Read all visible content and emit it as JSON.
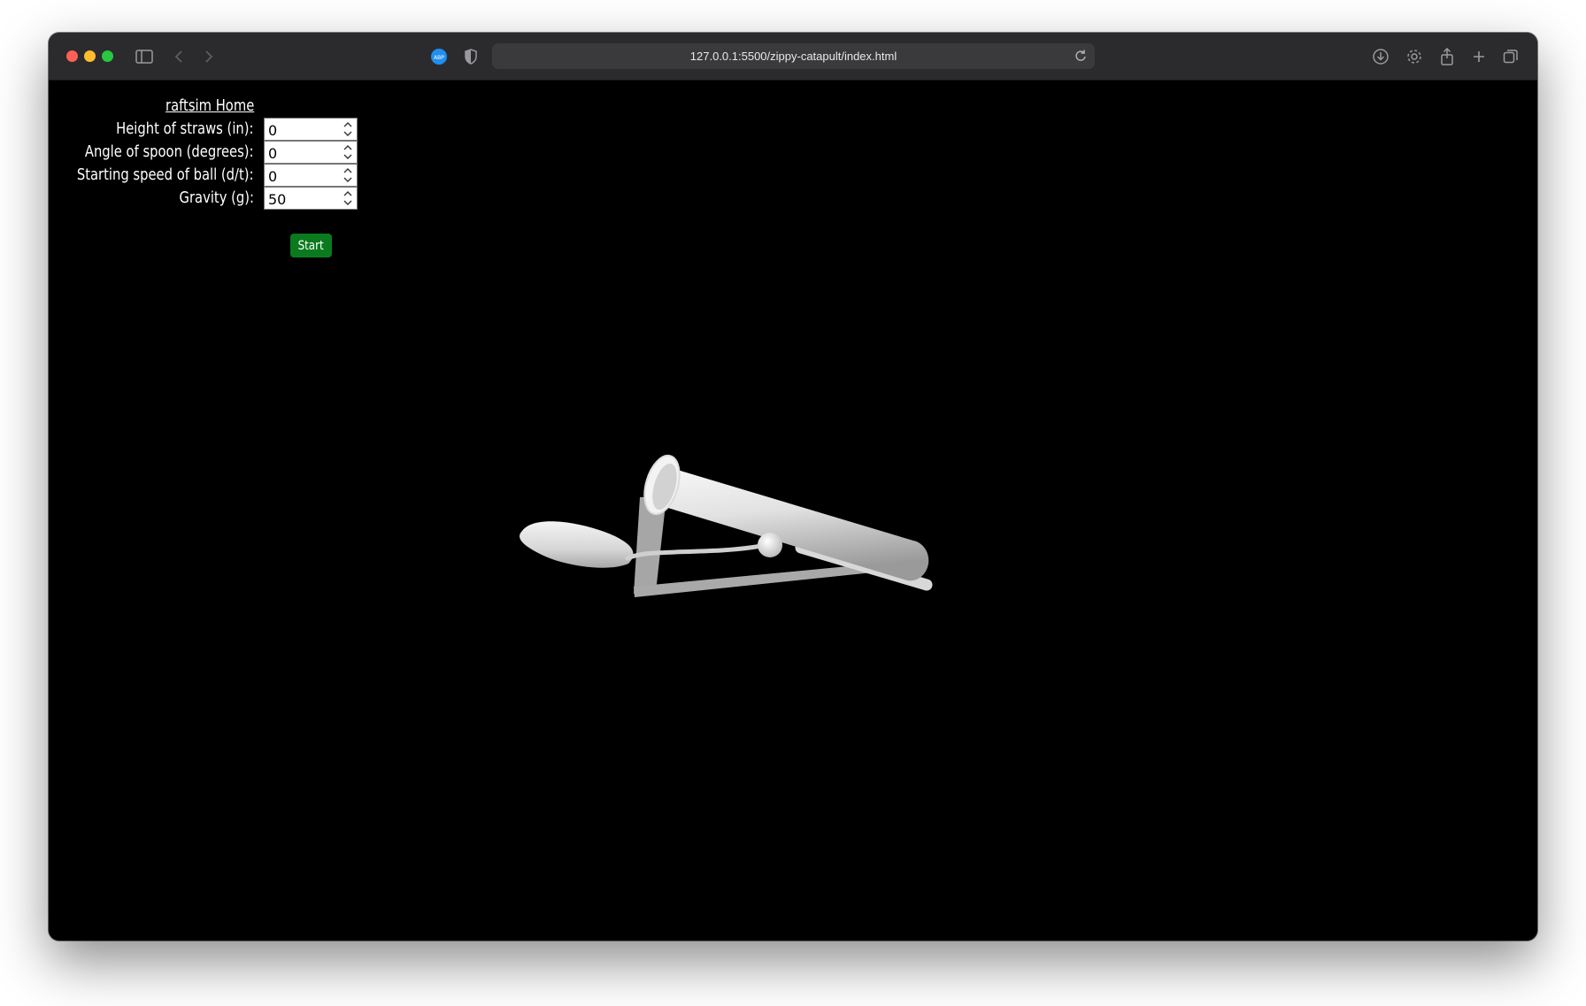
{
  "browser": {
    "url": "127.0.0.1:5500/zippy-catapult/index.html",
    "colors": {
      "close": "#ff5f57",
      "minimize": "#febc2e",
      "maximize": "#28c840",
      "titlebar": "#2b2b2d"
    }
  },
  "page": {
    "home_link": "raftsim Home",
    "fields": [
      {
        "label": "Height of straws (in):",
        "value": "0"
      },
      {
        "label": "Angle of spoon (degrees):",
        "value": "0"
      },
      {
        "label": "Starting speed of ball (d/t):",
        "value": "0"
      },
      {
        "label": "Gravity (g):",
        "value": "50"
      }
    ],
    "start_label": "Start",
    "start_color": "#0b7a1e",
    "background": "#000000"
  }
}
